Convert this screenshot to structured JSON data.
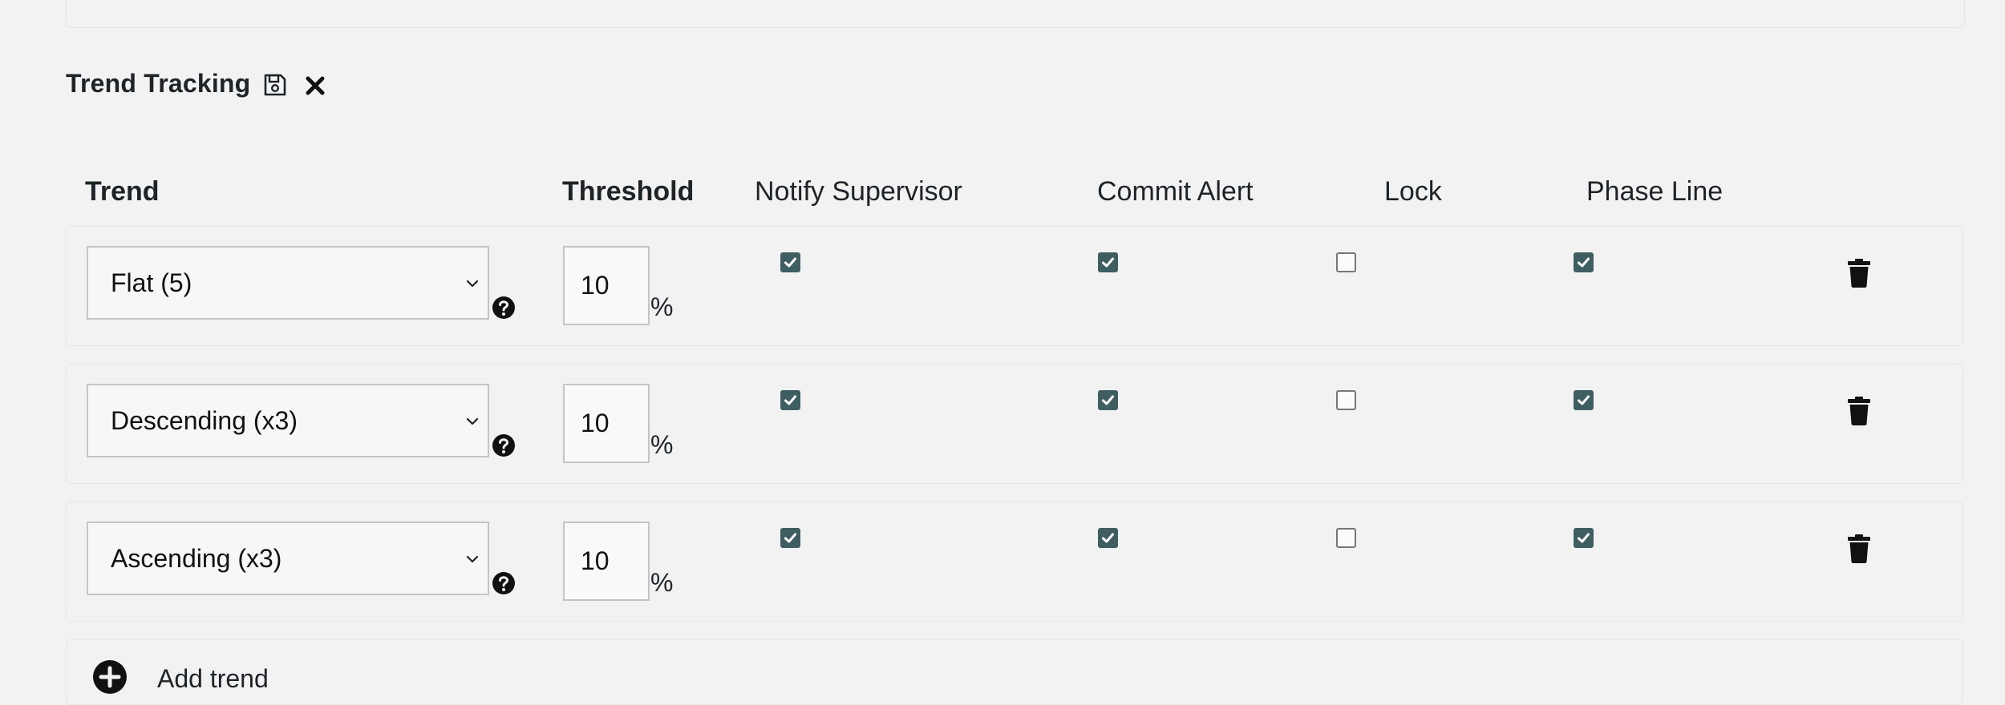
{
  "section": {
    "title": "Trend Tracking",
    "save_icon": "save-icon",
    "close_icon": "close-icon"
  },
  "columns": {
    "trend": "Trend",
    "threshold": "Threshold",
    "notify_supervisor": "Notify Supervisor",
    "commit_alert": "Commit Alert",
    "lock": "Lock",
    "phase_line": "Phase Line"
  },
  "rows": [
    {
      "trend": "Flat (5)",
      "threshold": "10",
      "unit": "%",
      "notify_supervisor": true,
      "commit_alert": true,
      "lock": false,
      "phase_line": true
    },
    {
      "trend": "Descending (x3)",
      "threshold": "10",
      "unit": "%",
      "notify_supervisor": true,
      "commit_alert": true,
      "lock": false,
      "phase_line": true
    },
    {
      "trend": "Ascending (x3)",
      "threshold": "10",
      "unit": "%",
      "notify_supervisor": true,
      "commit_alert": true,
      "lock": false,
      "phase_line": true
    }
  ],
  "add_button": {
    "label": "Add trend",
    "icon": "plus-circle-icon"
  },
  "colors": {
    "checkbox_checked": "#3e5e62",
    "background": "#f2f2f2",
    "text": "#1d2327"
  }
}
